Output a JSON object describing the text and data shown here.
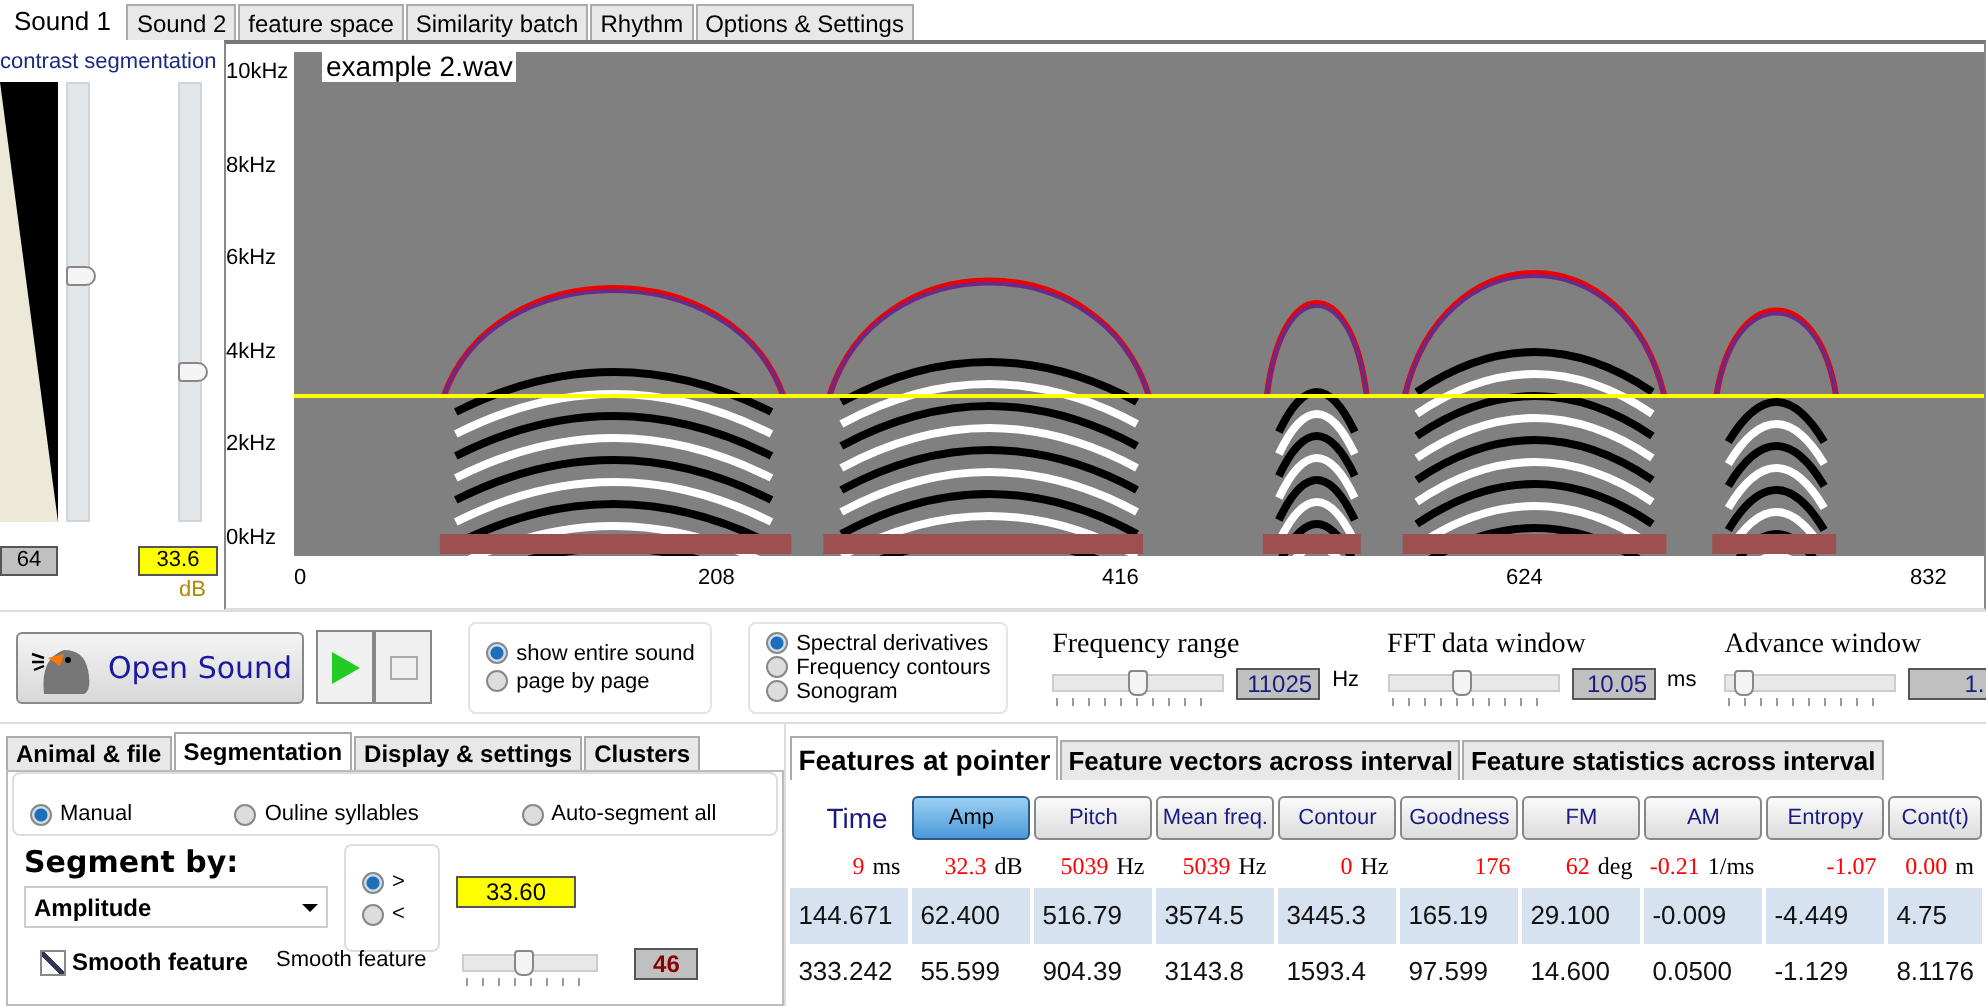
{
  "top_tabs": [
    {
      "label": "Sound 1",
      "selected": true
    },
    {
      "label": "Sound 2",
      "selected": false
    },
    {
      "label": "feature space",
      "selected": false
    },
    {
      "label": "Similarity batch",
      "selected": false
    },
    {
      "label": "Rhythm",
      "selected": false
    },
    {
      "label": "Options & Settings",
      "selected": false
    }
  ],
  "left_panel": {
    "title": "contrast segmentation",
    "contrast_slider": {
      "level": 0.56
    },
    "segmentation_slider": {
      "level": 0.34
    },
    "contrast_value": "64",
    "segmentation_value": "33.6",
    "segmentation_unit": "dB"
  },
  "spectrogram": {
    "file_name": "example 2.wav",
    "y_labels": [
      "10kHz",
      "8kHz",
      "6kHz",
      "4kHz",
      "2kHz",
      "0kHz"
    ],
    "x_labels": [
      "0",
      "208",
      "416",
      "624",
      "832"
    ]
  },
  "controls": {
    "open_button": "Open Sound",
    "view_options": [
      {
        "label": "show entire sound",
        "selected": true
      },
      {
        "label": "page by page",
        "selected": false
      }
    ],
    "display_options": [
      {
        "label": "Spectral derivatives",
        "selected": true
      },
      {
        "label": "Frequency contours",
        "selected": false
      },
      {
        "label": "Sonogram",
        "selected": false
      }
    ],
    "sliders": [
      {
        "label": "Frequency range",
        "level": 0.5,
        "value": "11025",
        "unit": "Hz"
      },
      {
        "label": "FFT data window",
        "level": 0.43,
        "value": "10.05",
        "unit": "ms"
      },
      {
        "label": "Advance window",
        "level": 0.1,
        "value": "1."
      }
    ]
  },
  "settings_panel": {
    "tabs": [
      {
        "label": "Animal & file",
        "selected": false
      },
      {
        "label": "Segmentation",
        "selected": true
      },
      {
        "label": "Display & settings",
        "selected": false
      },
      {
        "label": "Clusters",
        "selected": false
      }
    ],
    "mode_options": [
      {
        "label": "Manual",
        "selected": true
      },
      {
        "label": "Ouline syllables",
        "selected": false
      },
      {
        "label": "Auto-segment all",
        "selected": false
      }
    ],
    "segment_by_label": "Segment by:",
    "segment_by_value": "Amplitude",
    "comparison_options": [
      {
        "label": ">",
        "selected": true
      },
      {
        "label": "<",
        "selected": false
      }
    ],
    "threshold": "33.60",
    "smooth_checkbox": {
      "label": "Smooth feature",
      "checked": true
    },
    "smooth_label": "Smooth feature",
    "smooth_slider": {
      "level": 0.45
    },
    "smooth_value": "46"
  },
  "features_panel": {
    "tabs": [
      {
        "label": "Features at pointer",
        "selected": true
      },
      {
        "label": "Feature vectors across interval",
        "selected": false
      },
      {
        "label": "Feature statistics across interval",
        "selected": false
      }
    ],
    "time_label": "Time",
    "feature_buttons": [
      {
        "label": "Amp",
        "selected": true
      },
      {
        "label": "Pitch",
        "selected": false
      },
      {
        "label": "Mean freq.",
        "selected": false
      },
      {
        "label": "Contour",
        "selected": false
      },
      {
        "label": "Goodness",
        "selected": false
      },
      {
        "label": "FM",
        "selected": false
      },
      {
        "label": "AM",
        "selected": false
      },
      {
        "label": "Entropy",
        "selected": false
      },
      {
        "label": "Cont(t)",
        "selected": false
      }
    ],
    "readouts": [
      {
        "value": "9",
        "unit": "ms"
      },
      {
        "value": "32.3",
        "unit": "dB"
      },
      {
        "value": "5039",
        "unit": "Hz"
      },
      {
        "value": "5039",
        "unit": "Hz"
      },
      {
        "value": "0",
        "unit": "Hz"
      },
      {
        "value": "176"
      },
      {
        "value": "62",
        "unit": "deg"
      },
      {
        "value": "-0.21",
        "unit": "1/ms"
      },
      {
        "value": "-1.07"
      },
      {
        "value": "0.00",
        "unit": "m"
      }
    ],
    "table": {
      "rows": [
        [
          "144.671",
          "62.400",
          "516.79",
          "3574.5",
          "3445.3",
          "165.19",
          "29.100",
          "-0.009",
          "-4.449",
          "4.75"
        ],
        [
          "333.242",
          "55.599",
          "904.39",
          "3143.8",
          "1593.4",
          "97.599",
          "14.600",
          "0.0500",
          "-1.129",
          "8.1176"
        ]
      ]
    }
  }
}
